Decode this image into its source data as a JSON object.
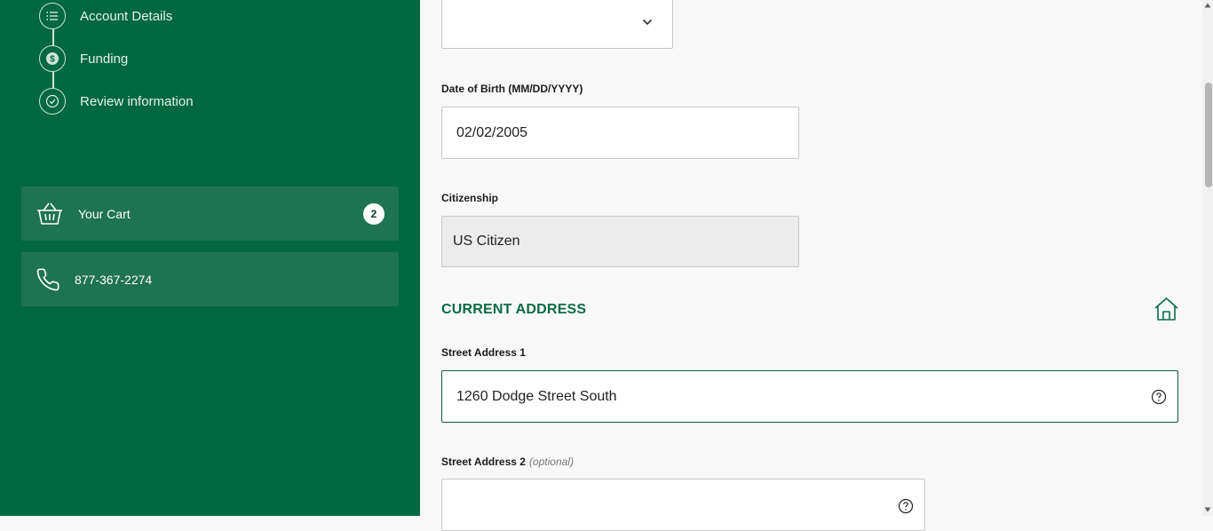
{
  "sidebar": {
    "steps": [
      {
        "label": "Account Details",
        "icon": "list-icon"
      },
      {
        "label": "Funding",
        "icon": "dollar-icon"
      },
      {
        "label": "Review information",
        "icon": "check-circle-icon"
      }
    ],
    "cart": {
      "label": "Your Cart",
      "count": "2"
    },
    "phone": {
      "number": "877-367-2274"
    }
  },
  "form": {
    "dob": {
      "label": "Date of Birth (MM/DD/YYYY)",
      "value": "02/02/2005"
    },
    "citizenship": {
      "label": "Citizenship",
      "value": "US Citizen"
    },
    "current_address": {
      "title": "CURRENT ADDRESS",
      "street1": {
        "label": "Street Address 1",
        "value": "1260 Dodge Street South"
      },
      "street2": {
        "label": "Street Address 2",
        "optional": "(optional)",
        "value": ""
      }
    }
  },
  "colors": {
    "sidebar_bg": "#006840",
    "card_bg": "#1e7353",
    "accent": "#0b6b47"
  }
}
